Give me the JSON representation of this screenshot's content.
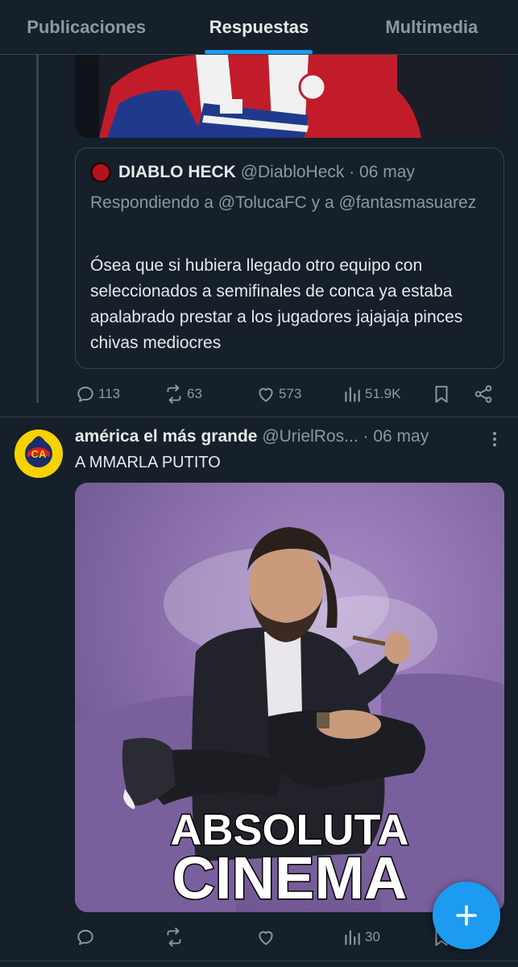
{
  "tabs": [
    {
      "label": "Publicaciones"
    },
    {
      "label": "Respuestas"
    },
    {
      "label": "Multimedia"
    }
  ],
  "colors": {
    "background": "#15202b",
    "accent": "#1d9bf0",
    "muted": "#8b98a5",
    "border": "#38444d"
  },
  "quote": {
    "name": "DIABLO HECK",
    "handle": "@DiabloHeck",
    "date": "· 06 may",
    "replying": "Respondiendo a @TolucaFC y a @fantasmasuarez",
    "text": "Ósea que si hubiera llegado otro equipo con seleccionados a semifinales de conca ya estaba apalabrado prestar a los jugadores jajajaja pinces chivas mediocres"
  },
  "tweet1_actions": {
    "replies": "113",
    "reposts": "63",
    "likes": "573",
    "views": "51.9K"
  },
  "tweet2": {
    "name": "américa el más grande",
    "handle": "@UrielRos...",
    "date": "· 06 may",
    "text": "A MMARLA PUTITO",
    "image_caption_1": "ABSOLUTA",
    "image_caption_2": "CINEMA"
  },
  "tweet2_actions": {
    "views": "30"
  },
  "icons": [
    "reply-icon",
    "repost-icon",
    "like-icon",
    "views-icon",
    "bookmark-icon",
    "share-icon",
    "more-icon",
    "compose-plus-icon"
  ]
}
